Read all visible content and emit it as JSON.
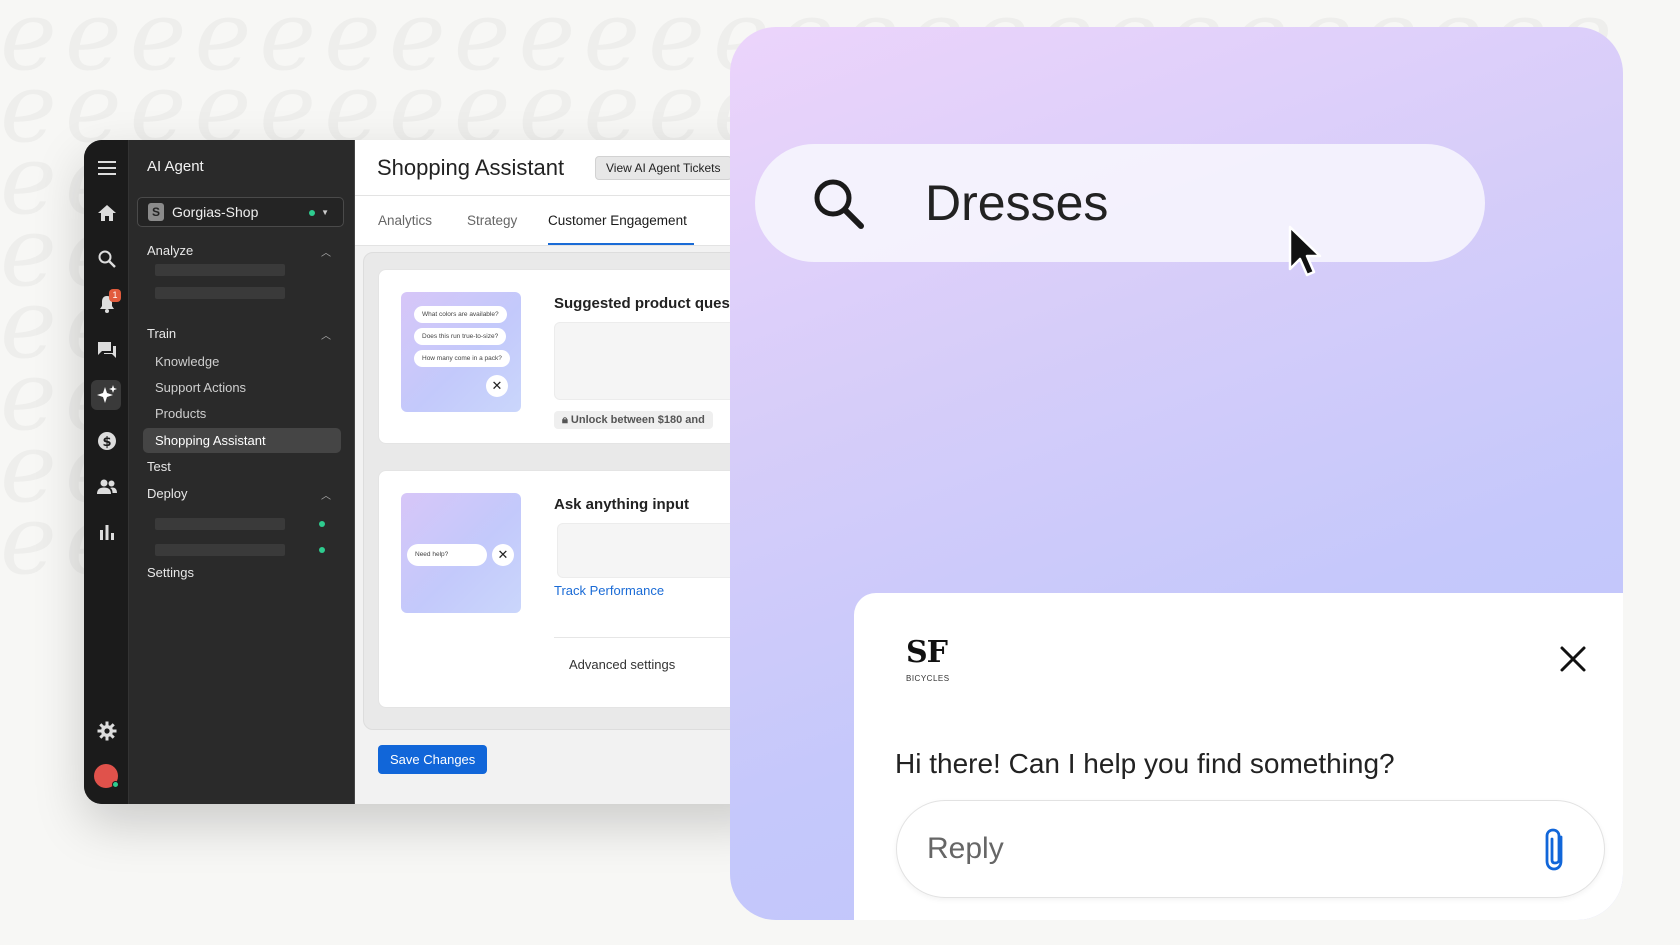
{
  "app": {
    "section_title": "AI Agent",
    "shop": {
      "name": "Gorgias-Shop",
      "icon": "shopify-icon",
      "status_color": "#2ecc8f"
    },
    "notification_count": "1",
    "rail_icons": [
      "menu-icon",
      "home-icon",
      "search-icon",
      "bell-icon",
      "chat-icon",
      "sparkle-icon",
      "dollar-icon",
      "users-icon",
      "bar-chart-icon",
      "gear-icon"
    ],
    "nav": {
      "analyze": "Analyze",
      "train": "Train",
      "train_items": [
        "Knowledge",
        "Support Actions",
        "Products",
        "Shopping Assistant"
      ],
      "test": "Test",
      "deploy": "Deploy",
      "settings": "Settings"
    },
    "page": {
      "title": "Shopping Assistant",
      "view_tickets": "View AI Agent Tickets",
      "tabs": [
        "Analytics",
        "Strategy",
        "Customer Engagement"
      ],
      "active_tab": "Customer Engagement",
      "card1": {
        "title": "Suggested product ques",
        "pills": [
          "What colors are available?",
          "Does this run true-to-size?",
          "How many come in a pack?"
        ],
        "unlock": "Unlock between $180 and"
      },
      "card2": {
        "title": "Ask anything input",
        "pill": "Need help?",
        "link": "Track Performance",
        "advanced": "Advanced settings"
      },
      "save": "Save Changes"
    },
    "accent_color": "#1166d9"
  },
  "widget": {
    "search_value": "Dresses",
    "brand": {
      "logo": "SF",
      "sub": "BICYCLES"
    },
    "greeting": "Hi there! Can I help you find something?",
    "reply_placeholder": "Reply"
  }
}
